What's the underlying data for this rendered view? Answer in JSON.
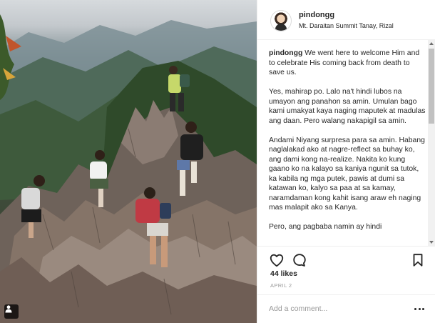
{
  "post": {
    "username": "pindongg",
    "location": "Mt. Daraitan Summit Tanay, Rizal",
    "caption_user": "pindongg",
    "caption_text": " We went here to welcome Him and to celebrate His coming back from death to save us.\n\nYes, mahirap po. Lalo na't hindi lubos na umayon ang panahon sa amin. Umulan bago kami umakyat kaya naging maputek at madulas ang daan. Pero walang nakapigil sa amin.\n\nAndami Niyang surpresa para sa amin. Habang naglalakad ako at nagre-reflect sa buhay ko, ang dami kong na-realize. Nakita ko kung gaano ko na kalayo sa kaniya ngunit sa tutok, ka kabila ng mga putek, pawis at dumi sa katawan ko, kalyo sa paa at sa kamay, naramdaman kong kahit isang araw eh naging mas malapit ako sa Kanya.\n\nPero, ang pagbaba namin ay hindi",
    "likes": "44 likes",
    "date": "APRIL 2",
    "comment_placeholder": "Add a comment..."
  },
  "icons": {
    "like": "heart-icon",
    "comment": "comment-bubble-icon",
    "save": "bookmark-icon",
    "more": "more-options-icon",
    "tagged": "user-tag-icon"
  },
  "colors": {
    "text": "#262626",
    "muted": "#999999",
    "border": "#efefef"
  }
}
